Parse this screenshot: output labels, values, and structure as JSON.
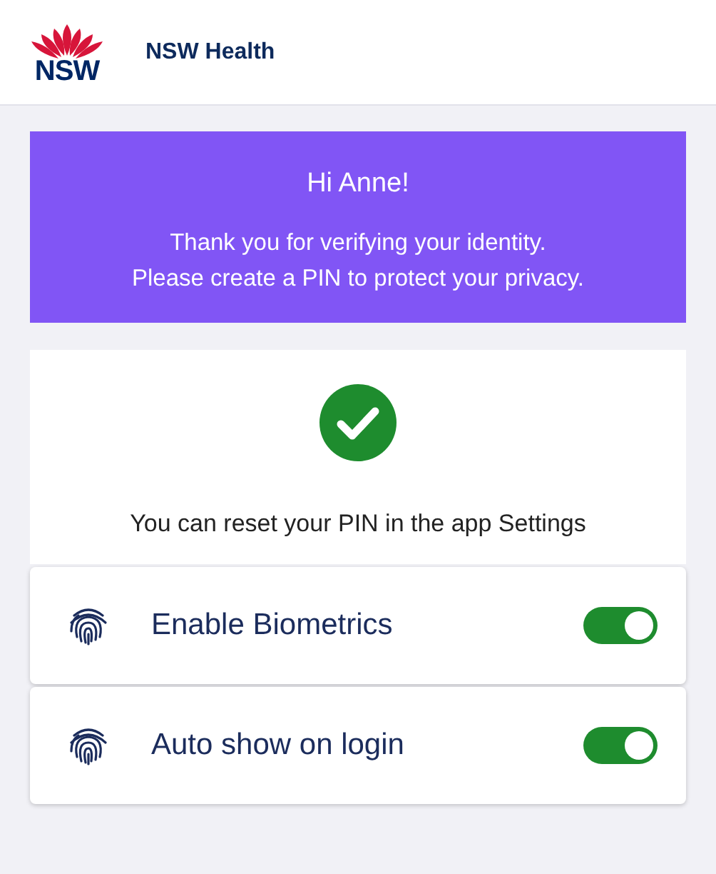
{
  "header": {
    "logo_text": "NSW",
    "title": "NSW Health"
  },
  "banner": {
    "greeting": "Hi Anne!",
    "message": "Thank you for verifying your identity.\nPlease create a PIN to protect your privacy."
  },
  "confirmation": {
    "message": "You can reset your PIN in the app Settings"
  },
  "settings": [
    {
      "label": "Enable Biometrics",
      "on": true
    },
    {
      "label": "Auto show on login",
      "on": true
    }
  ]
}
